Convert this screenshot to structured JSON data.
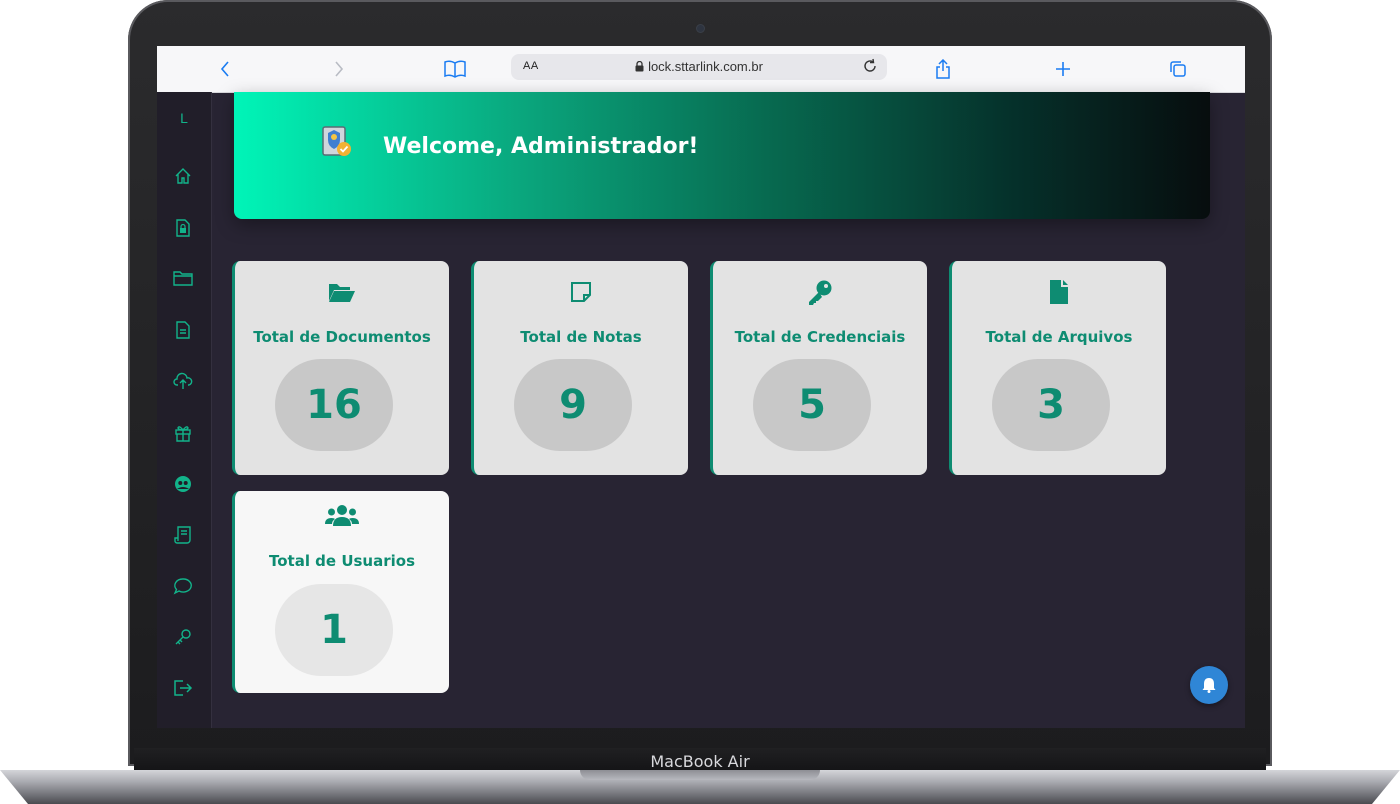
{
  "browser": {
    "text_size_label": "AA",
    "url": "lock.sttarlink.com.br"
  },
  "sidebar": {
    "logo_letter": "L",
    "items": [
      {
        "icon": "home-icon"
      },
      {
        "icon": "secure-document-icon"
      },
      {
        "icon": "folder-icon"
      },
      {
        "icon": "document-icon"
      },
      {
        "icon": "cloud-upload-icon"
      },
      {
        "icon": "gift-icon"
      },
      {
        "icon": "users-circle-icon"
      },
      {
        "icon": "receipt-icon"
      },
      {
        "icon": "chat-icon"
      },
      {
        "icon": "key-icon"
      },
      {
        "icon": "logout-icon"
      }
    ]
  },
  "banner": {
    "title": "Welcome, Administrador!"
  },
  "cards": [
    {
      "title": "Total de Documentos",
      "count": "16",
      "icon": "folder-open-icon"
    },
    {
      "title": "Total de Notas",
      "count": "9",
      "icon": "note-icon"
    },
    {
      "title": "Total de Credenciais",
      "count": "5",
      "icon": "key-icon"
    },
    {
      "title": "Total de Arquivos",
      "count": "3",
      "icon": "file-icon"
    },
    {
      "title": "Total de Usuarios",
      "count": "1",
      "icon": "users-icon"
    }
  ],
  "device": {
    "brand": "MacBook Air"
  },
  "colors": {
    "accent": "#0e8c72",
    "background": "#282433",
    "notification": "#2f86d6"
  }
}
